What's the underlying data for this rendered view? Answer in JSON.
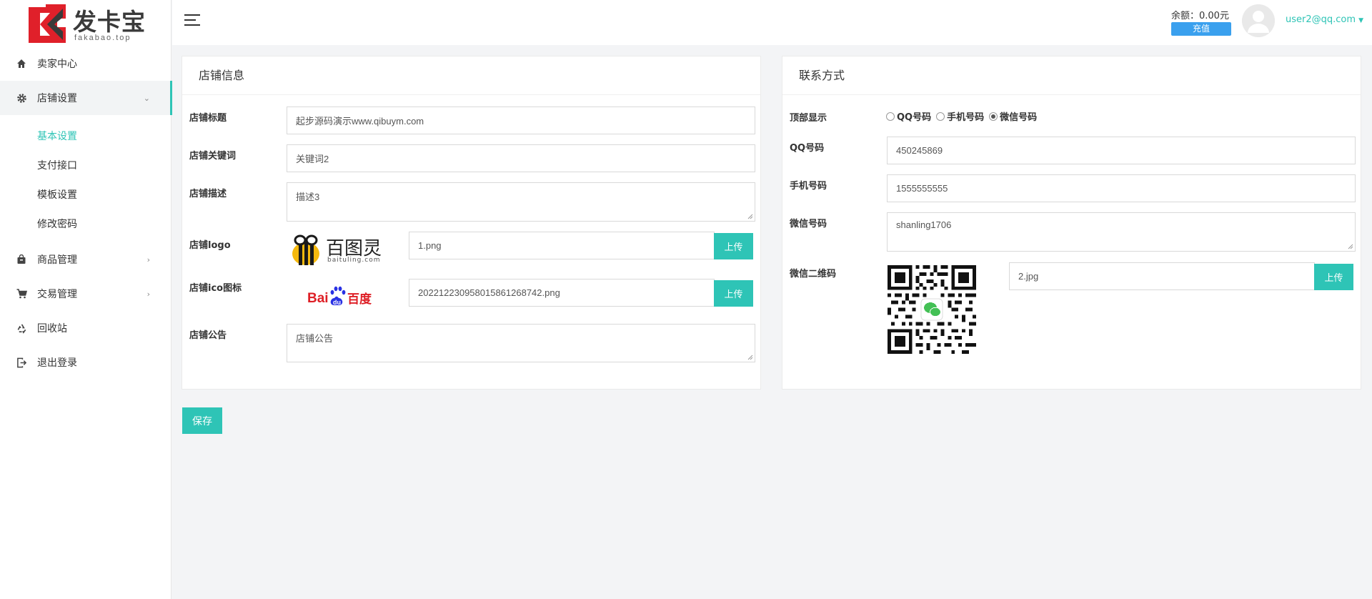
{
  "brand": {
    "name": "发卡宝",
    "domain": "fakabao.top",
    "color": "#e0202a"
  },
  "accent": "#2ec4b6",
  "sidebar": {
    "items": [
      {
        "label": "卖家中心",
        "icon": "home-icon"
      },
      {
        "label": "店铺设置",
        "icon": "gear-icon",
        "expanded": true
      },
      {
        "label": "商品管理",
        "icon": "bag-icon"
      },
      {
        "label": "交易管理",
        "icon": "cart-icon"
      },
      {
        "label": "回收站",
        "icon": "recycle-icon"
      },
      {
        "label": "退出登录",
        "icon": "logout-icon"
      }
    ],
    "sub_items": [
      {
        "label": "基本设置",
        "active": true
      },
      {
        "label": "支付接口"
      },
      {
        "label": "模板设置"
      },
      {
        "label": "修改密码"
      }
    ]
  },
  "header": {
    "balance": "余额：0.00元",
    "recharge_label": "充值",
    "user_email": "user2@qq.com"
  },
  "shop_info": {
    "title": "店铺信息",
    "fields": {
      "shop_title": {
        "label": "店铺标题",
        "value": "起步源码演示www.qibuym.com"
      },
      "keywords": {
        "label": "店铺关键词",
        "value": "关键词2"
      },
      "description": {
        "label": "店铺描述",
        "value": "描述3"
      },
      "logo": {
        "label": "店铺logo",
        "value": "1.png",
        "upload_label": "上传",
        "preview_text": "百图灵",
        "preview_sub": "baituling.com"
      },
      "ico": {
        "label": "店铺ico图标",
        "value": "20221223095801586126874‌2.png",
        "upload_label": "上传",
        "preview_text": "Bai百度"
      },
      "notice": {
        "label": "店铺公告",
        "value": "店铺公告"
      }
    }
  },
  "contact": {
    "title": "联系方式",
    "top_display": {
      "label": "顶部显示",
      "options": [
        "QQ号码",
        "手机号码",
        "微信号码"
      ],
      "selected": "微信号码"
    },
    "fields": {
      "qq": {
        "label": "QQ号码",
        "value": "450245869"
      },
      "phone": {
        "label": "手机号码",
        "value": "1555555555"
      },
      "wechat": {
        "label": "微信号码",
        "value": "shanling1706"
      },
      "wechat_qr": {
        "label": "微信二维码",
        "value": "2.jpg",
        "upload_label": "上传"
      }
    }
  },
  "save_label": "保存"
}
